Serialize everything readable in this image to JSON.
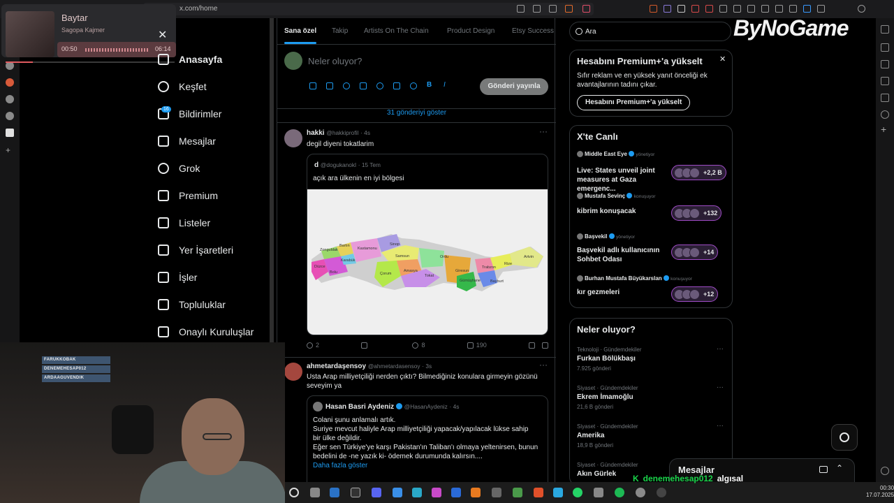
{
  "browser": {
    "url": "x.com/home"
  },
  "media": {
    "title": "Baytar",
    "artist": "Sagopa Kajmer",
    "elapsed": "00:50",
    "duration": "06:14",
    "progress": 0.16
  },
  "nav": {
    "items": [
      {
        "key": "home",
        "label": "Anasayfa",
        "icon": "home-icon"
      },
      {
        "key": "explore",
        "label": "Keşfet",
        "icon": "search-icon"
      },
      {
        "key": "notifications",
        "label": "Bildirimler",
        "icon": "bell-icon",
        "badge": "16"
      },
      {
        "key": "messages",
        "label": "Mesajlar",
        "icon": "mail-icon"
      },
      {
        "key": "grok",
        "label": "Grok",
        "icon": "grok-icon"
      },
      {
        "key": "premium",
        "label": "Premium",
        "icon": "x-logo-icon"
      },
      {
        "key": "lists",
        "label": "Listeler",
        "icon": "list-icon"
      },
      {
        "key": "bookmarks",
        "label": "Yer İşaretleri",
        "icon": "bookmark-icon"
      },
      {
        "key": "jobs",
        "label": "İşler",
        "icon": "briefcase-icon"
      },
      {
        "key": "communities",
        "label": "Topluluklar",
        "icon": "people-icon"
      },
      {
        "key": "verified_orgs",
        "label": "Onaylı Kuruluşlar",
        "icon": "lightning-icon"
      }
    ]
  },
  "tabs": [
    "Sana özel",
    "Takip",
    "Artists On The Chain",
    "Product Design",
    "Etsy Success"
  ],
  "compose": {
    "placeholder": "Neler oluyor?",
    "post_button": "Gönderi yayınla"
  },
  "show_more": "31 gönderiyi göster",
  "posts": [
    {
      "name": "hakki",
      "handle": "@hakkiprofil",
      "time": "· 4s",
      "text": "degil diyeni tokatlarim",
      "quote": {
        "name": "d",
        "handle": "@dogukanokl",
        "time": "· 15 Tem",
        "text": "açık ara ülkenin en iyi bölgesi",
        "map_labels": [
          "Zonguldak",
          "Bartın",
          "Kastamonu",
          "Sinop",
          "Karabük",
          "Düzce",
          "Bolu",
          "Samsun",
          "Amasya",
          "Çorum",
          "Tokat",
          "Ordu",
          "Giresun",
          "Trabzon",
          "Rize",
          "Artvin",
          "Gümüşhane",
          "Bayburt"
        ]
      },
      "stats": {
        "replies": "2",
        "reposts": "",
        "likes": "8",
        "views": "190"
      }
    },
    {
      "name": "ahmetardaşensoy",
      "handle": "@ahmetardasensoy",
      "time": "· 3s",
      "text": "Usta Arap milliyetçiliği nerden çıktı? Bilmediğiniz konulara girmeyin gözünü seveyim ya",
      "quote": {
        "name": "Hasan Basri Aydeniz",
        "handle": "@HasanAydeniz",
        "time": "· 4s",
        "lines": [
          "Colani şunu anlamalı artık.",
          "Suriye mevcut haliyle Arap milliyetçiliği yapacak/yapılacak lükse sahip",
          "bir ülke değildir.",
          "Eğer sen Türkiye'ye karşı Pakistan'ın Taliban'ı olmaya yeltenirsen, bunun",
          "bedelini de -ne yazık ki- ödemek durumunda kalırsın...."
        ],
        "more": "Daha fazla göster"
      }
    }
  ],
  "search": {
    "value": "Ara"
  },
  "logo": "ByNoGame",
  "premium": {
    "title": "Hesabını Premium+'a yükselt",
    "desc": "Sıfır reklam ve en yüksek yanıt önceliği ek avantajlarının tadını çıkar.",
    "button": "Hesabını Premium+'a yükselt"
  },
  "live": {
    "title": "X'te Canlı",
    "items": [
      {
        "host": "Middle East Eye",
        "role": "yönetiyor",
        "title": "Live: States unveil joint measures at Gaza emergenc...",
        "count": "+2,2 B"
      },
      {
        "host": "Mustafa Sevinç",
        "role": "konuşuyor",
        "title": "kibrim konuşacak",
        "count": "+132"
      },
      {
        "host": "Başvekil",
        "role": "yönetiyor",
        "title": "Başvekil adlı kullanıcının Sohbet Odası",
        "count": "+14"
      },
      {
        "host": "Burhan Mustafa Büyükarslan",
        "role": "konuşuyor",
        "title": "kır gezmeleri",
        "count": "+12"
      }
    ]
  },
  "trends": {
    "title": "Neler oluyor?",
    "items": [
      {
        "meta": "Teknoloji · Gündemdekiler",
        "name": "Furkan Bölükbaşı",
        "posts": "7.925 gönderi"
      },
      {
        "meta": "Siyaset · Gündemdekiler",
        "name": "Ekrem İmamoğlu",
        "posts": "21,6 B gönderi"
      },
      {
        "meta": "Siyaset · Gündemdekiler",
        "name": "Amerika",
        "posts": "18,9 B gönderi"
      },
      {
        "meta": "Siyaset · Gündemdekiler",
        "name": "Akın Gürlek",
        "posts": ""
      }
    ]
  },
  "messages": {
    "title": "Mesajlar"
  },
  "stream": {
    "followers": [
      "FARUKKOBAK",
      "DENEMEHESAP012",
      "ARDAAGUVENDIK"
    ],
    "alert_user": "denemehesap012",
    "alert_text": "algısal"
  },
  "clock": {
    "time": "00:30",
    "date": "17.07.2025"
  },
  "colors": {
    "accent": "#1d9bf0",
    "bg": "#000000",
    "alert": "#19d44a"
  }
}
